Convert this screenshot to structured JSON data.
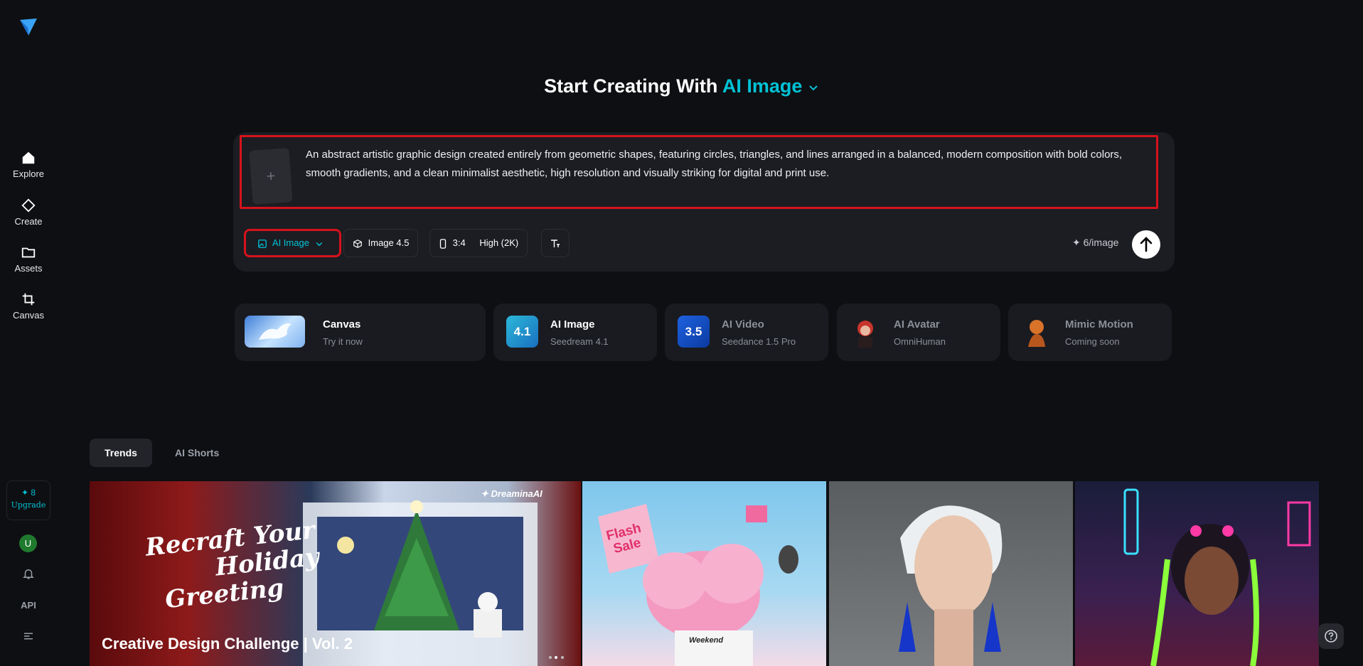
{
  "sidebar": {
    "items": [
      {
        "label": "Explore",
        "icon": "home-icon"
      },
      {
        "label": "Create",
        "icon": "diamond-icon"
      },
      {
        "label": "Assets",
        "icon": "folder-icon"
      },
      {
        "label": "Canvas",
        "icon": "crop-icon"
      }
    ],
    "credits": {
      "count": "✦ 8",
      "upgrade": "Upgrade"
    },
    "avatar_letter": "U",
    "api_label": "API"
  },
  "hero": {
    "title_prefix": "Start Creating With",
    "title_accent": "AI Image"
  },
  "prompt": {
    "text": "An abstract artistic graphic design created entirely from geometric shapes, featuring circles, triangles, and lines arranged in a balanced, modern composition with bold colors, smooth gradients, and a clean minimalist aesthetic, high resolution and visually striking for digital and print use.",
    "upload_symbol": "+"
  },
  "toolbar": {
    "mode": "AI Image",
    "model": "Image 4.5",
    "ratio": "3:4",
    "quality": "High (2K)",
    "cost": "✦ 6/image"
  },
  "tools": [
    {
      "name": "Canvas",
      "sub": "Try it now"
    },
    {
      "name": "AI Image",
      "sub": "Seedream 4.1",
      "badge": "4.1"
    },
    {
      "name": "AI Video",
      "sub": "Seedance 1.5 Pro",
      "badge": "3.5"
    },
    {
      "name": "AI Avatar",
      "sub": "OmniHuman"
    },
    {
      "name": "Mimic Motion",
      "sub": "Coming soon"
    }
  ],
  "tabs": {
    "active": "Trends",
    "inactive": "AI Shorts"
  },
  "gallery": {
    "featured_title": "Creative Design Challenge | Vol. 2",
    "featured_art_line1": "Recraft Your",
    "featured_art_line2": "Holiday",
    "featured_art_line3": "Greeting",
    "featured_brand": "DreaminaAI",
    "flash_sale_1": "Flash",
    "flash_sale_2": "Sale",
    "weekend_label": "Weekend"
  },
  "colors": {
    "accent": "#00c2d6",
    "highlight": "#d6121c",
    "bg": "#0e0f12"
  }
}
